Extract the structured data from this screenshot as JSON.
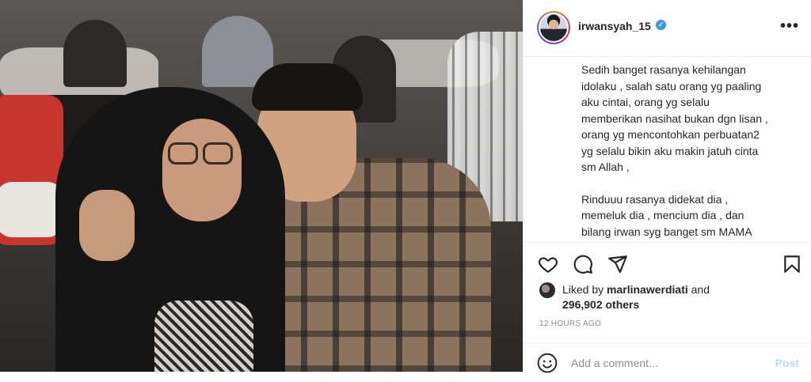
{
  "post": {
    "username": "irwansyah_15",
    "verified_symbol": "✓",
    "more_label": "•••",
    "caption_paragraphs": [
      [
        "Sedih banget rasanya kehilangan",
        "idolaku , salah satu orang yg paaling",
        "aku cintai, orang yg selalu",
        "memberikan nasihat bukan dgn lisan ,",
        "orang yg mencontohkan perbuatan2",
        "yg selalu bikin aku makin jatuh cinta",
        "sm Allah ,"
      ],
      [
        "Rinduuu rasanya didekat dia ,",
        "memeluk dia , mencium dia , dan",
        "bilang irwan syg banget sm MAMA"
      ]
    ],
    "likes": {
      "prefix": "Liked by ",
      "liker": "marlinawerdiati",
      "and": " and",
      "others": "296,902 others"
    },
    "timestamp": "12 HOURS AGO"
  },
  "comment": {
    "placeholder": "Add a comment...",
    "post_label": "Post"
  },
  "icons": {
    "like": "heart-icon",
    "comment": "comment-icon",
    "share": "paper-plane-icon",
    "save": "bookmark-icon",
    "emoji": "smiley-icon",
    "more": "ellipsis-icon"
  },
  "colors": {
    "verified": "#3897f0",
    "post_button_disabled": "#b2dffc",
    "muted_text": "#8e8e8e",
    "text": "#262626",
    "divider": "#efefef"
  }
}
